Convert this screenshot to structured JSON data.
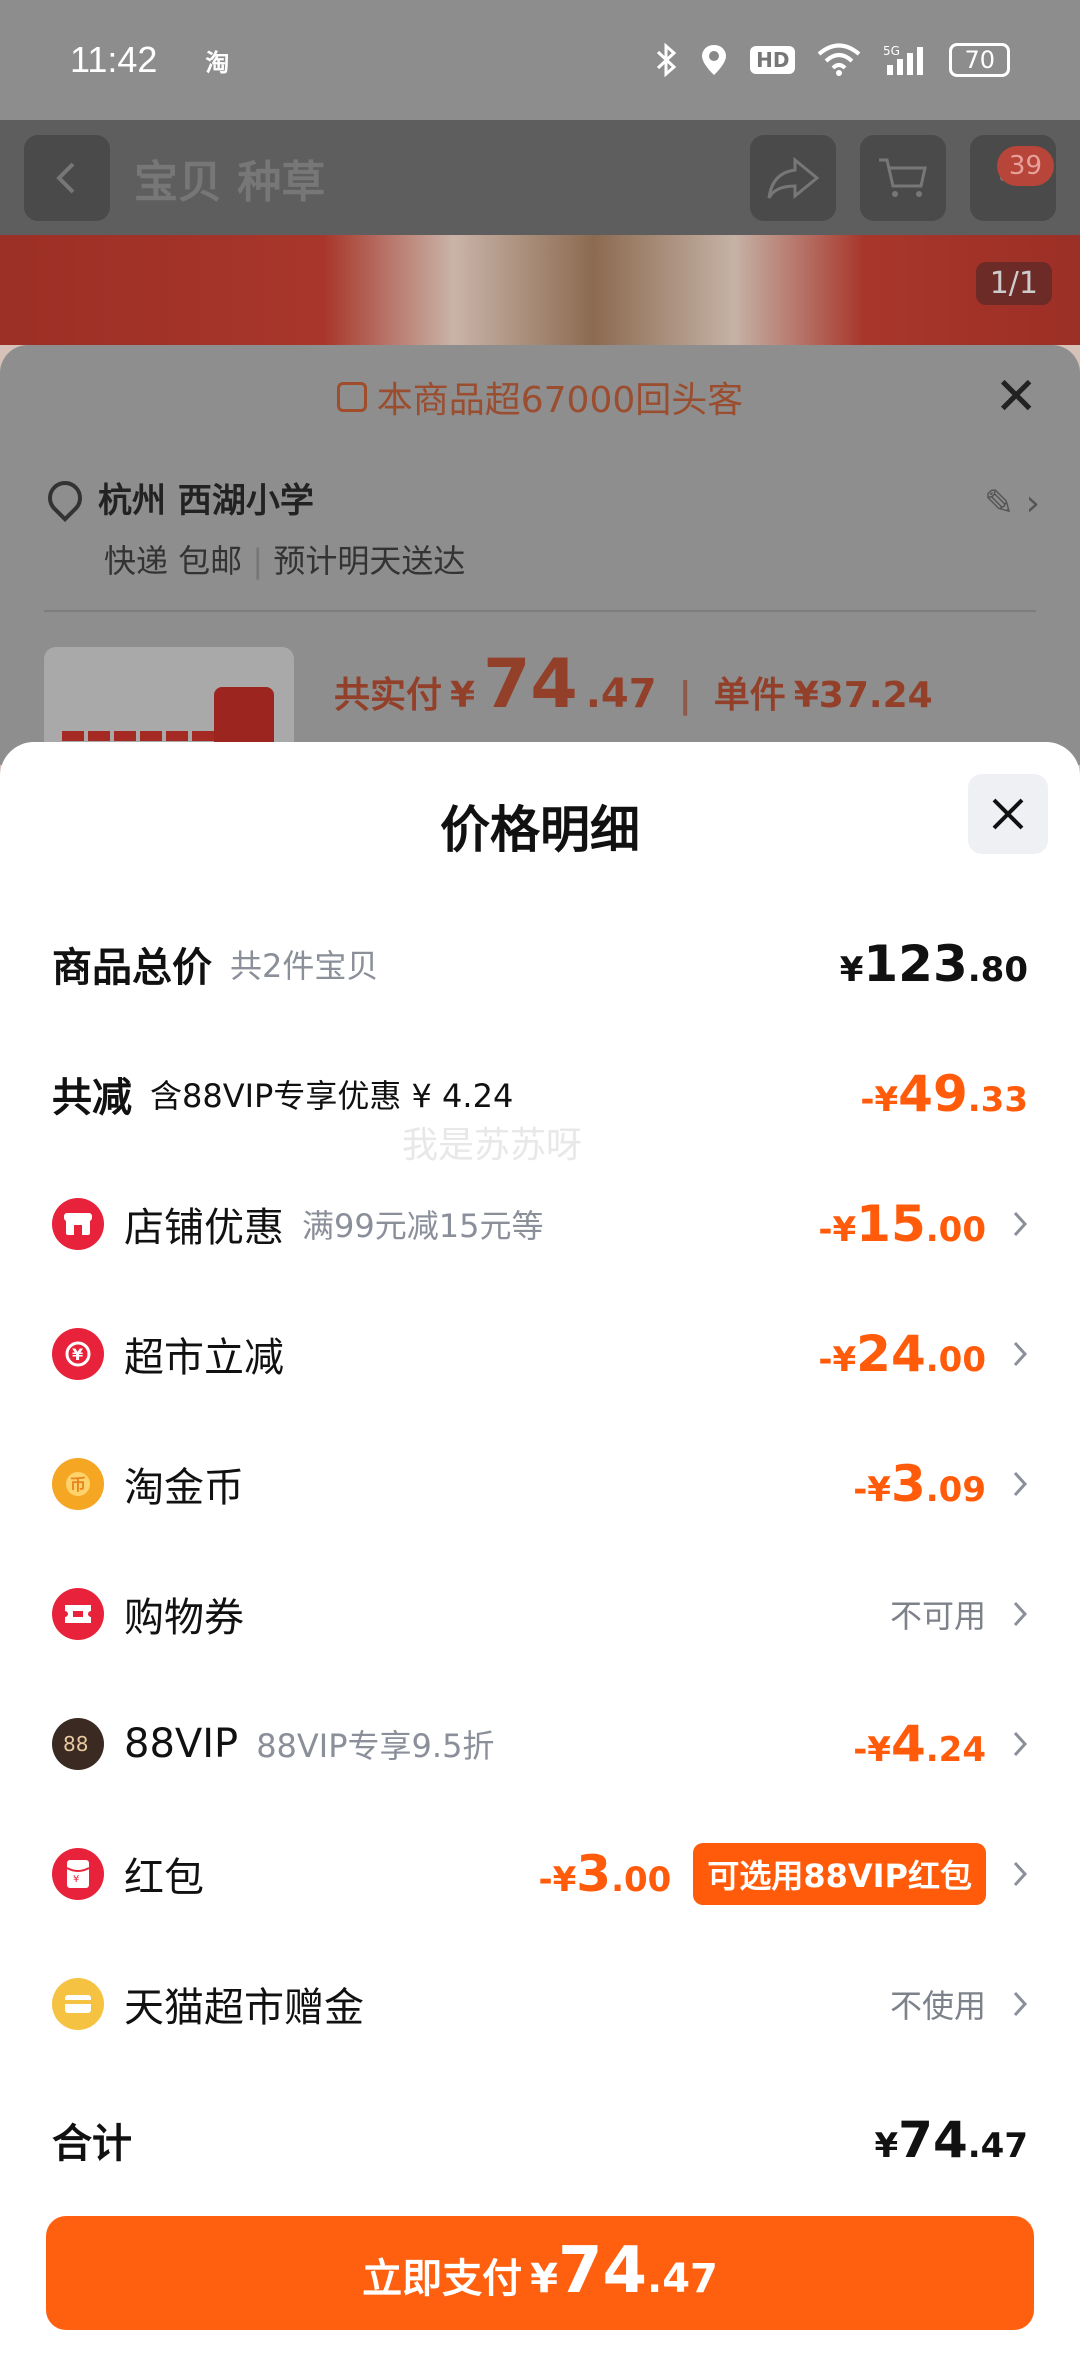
{
  "status_bar": {
    "time": "11:42",
    "app_glyph": "淘",
    "battery": "70",
    "hd": "HD",
    "network": "5G"
  },
  "nav": {
    "title": "宝贝  种草",
    "cart_badge": "39",
    "page_indicator": "1/1"
  },
  "under_sheet": {
    "hint": "本商品超67000回头客",
    "address_city": "杭州 西湖小学",
    "delivery": "快递 包邮",
    "eta": "预计明天送达",
    "paid_label": "共实付",
    "paid_currency": "¥",
    "paid_int": "74",
    "paid_dec": ".47",
    "unit_label": "单件",
    "unit_price": "¥37.24"
  },
  "sheet": {
    "title": "价格明细",
    "total": {
      "label": "商品总价",
      "desc": "共2件宝贝",
      "cur": "¥",
      "int": "123",
      "dec": ".80"
    },
    "reduce": {
      "label": "共减",
      "desc": "含88VIP专享优惠 ¥ 4.24",
      "cur": "-¥",
      "int": "49",
      "dec": ".33"
    },
    "items": [
      {
        "label": "店铺优惠",
        "desc": "满99元减15元等",
        "cur": "-¥",
        "int": "15",
        "dec": ".00",
        "icon": "store-icon",
        "color": "#e8223a"
      },
      {
        "label": "超市立减",
        "desc": "",
        "cur": "-¥",
        "int": "24",
        "dec": ".00",
        "icon": "discount-icon",
        "color": "#e8223a"
      },
      {
        "label": "淘金币",
        "desc": "",
        "cur": "-¥",
        "int": "3",
        "dec": ".09",
        "icon": "coin-icon",
        "color": "#f5a623"
      },
      {
        "label": "购物券",
        "desc": "",
        "status": "不可用",
        "icon": "coupon-icon",
        "color": "#e8223a"
      },
      {
        "label": "88VIP",
        "desc": "88VIP专享9.5折",
        "cur": "-¥",
        "int": "4",
        "dec": ".24",
        "icon": "vip88-icon",
        "color": "#3a2a22"
      },
      {
        "label": "红包",
        "desc": "",
        "cur": "-¥",
        "int": "3",
        "dec": ".00",
        "tag": "可选用88VIP红包",
        "icon": "redpacket-icon",
        "color": "#e8223a"
      },
      {
        "label": "天猫超市赠金",
        "desc": "",
        "status": "不使用",
        "icon": "gift-money-icon",
        "color": "#f5c242"
      }
    ],
    "sum": {
      "label": "合计",
      "cur": "¥",
      "int": "74",
      "dec": ".47"
    },
    "watermark": "我是苏苏呀"
  },
  "pay_button": {
    "label": "立即支付",
    "cur": "¥",
    "int": "74",
    "dec": ".47"
  },
  "colors": {
    "accent": "#ff6010",
    "discount": "#ff5b0a",
    "muted": "#8a8f99"
  }
}
